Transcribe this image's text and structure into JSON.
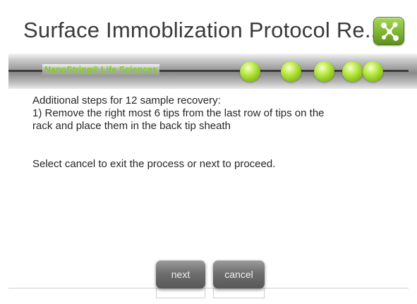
{
  "header": {
    "title": "Surface Immoblization Protocol Re...",
    "app_icon": "network-nodes-icon"
  },
  "banner": {
    "brand": "NanoString® Life Sciences",
    "progress_steps": 5
  },
  "content": {
    "line1": "Additional steps for 12 sample recovery:",
    "line2": "1) Remove the right most 6 tips from the last row of tips on the",
    "line3": "rack and place them in the back tip sheath",
    "line4": "Select cancel to exit the process or next to proceed."
  },
  "buttons": {
    "next": "next",
    "cancel": "cancel"
  },
  "colors": {
    "accent_green": "#98d020",
    "brand_text": "#7fcf1a",
    "button_gray": "#6f6f6f"
  }
}
